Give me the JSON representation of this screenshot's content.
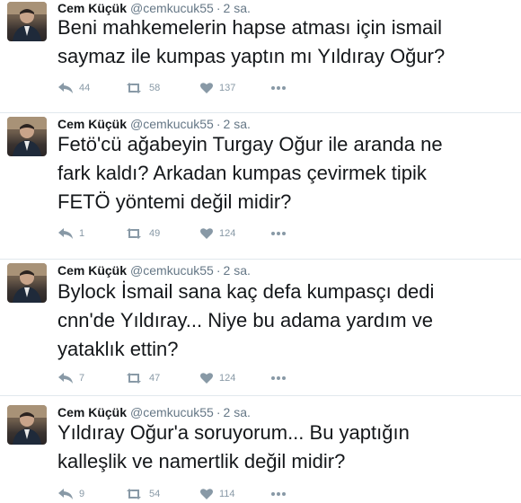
{
  "colors": {
    "text": "#14171a",
    "meta": "#657786",
    "icons": "#8899a6",
    "border": "#e1e8ed"
  },
  "tweets": [
    {
      "name": "Cem Küçük",
      "handle": "@cemkucuk55",
      "separator": "·",
      "time": "2 sa.",
      "text_lines": [
        "Beni mahkemelerin hapse atması için ismail",
        "saymaz ile kumpas yaptın mı Yıldıray Oğur?"
      ],
      "replies": "44",
      "retweets": "58",
      "likes": "137"
    },
    {
      "name": "Cem Küçük",
      "handle": "@cemkucuk55",
      "separator": "·",
      "time": "2 sa.",
      "text_lines": [
        "Fetö'cü ağabeyin Turgay Oğur ile aranda ne",
        "fark kaldı? Arkadan kumpas çevirmek tipik",
        "FETÖ yöntemi değil midir?"
      ],
      "replies": "1",
      "retweets": "49",
      "likes": "124"
    },
    {
      "name": "Cem Küçük",
      "handle": "@cemkucuk55",
      "separator": "·",
      "time": "2 sa.",
      "text_lines": [
        "Bylock İsmail sana kaç defa kumpasçı dedi",
        "cnn'de Yıldıray... Niye bu adama yardım ve",
        "yataklık ettin?"
      ],
      "replies": "7",
      "retweets": "47",
      "likes": "124"
    },
    {
      "name": "Cem Küçük",
      "handle": "@cemkucuk55",
      "separator": "·",
      "time": "2 sa.",
      "text_lines": [
        "Yıldıray Oğur'a soruyorum... Bu yaptığın",
        "kalleşlik ve namertlik değil midir?"
      ],
      "replies": "9",
      "retweets": "54",
      "likes": "114"
    }
  ],
  "icons": {
    "reply": "reply-icon",
    "retweet": "retweet-icon",
    "like": "heart-icon",
    "more": "more-dots-icon",
    "avatar": "avatar"
  }
}
